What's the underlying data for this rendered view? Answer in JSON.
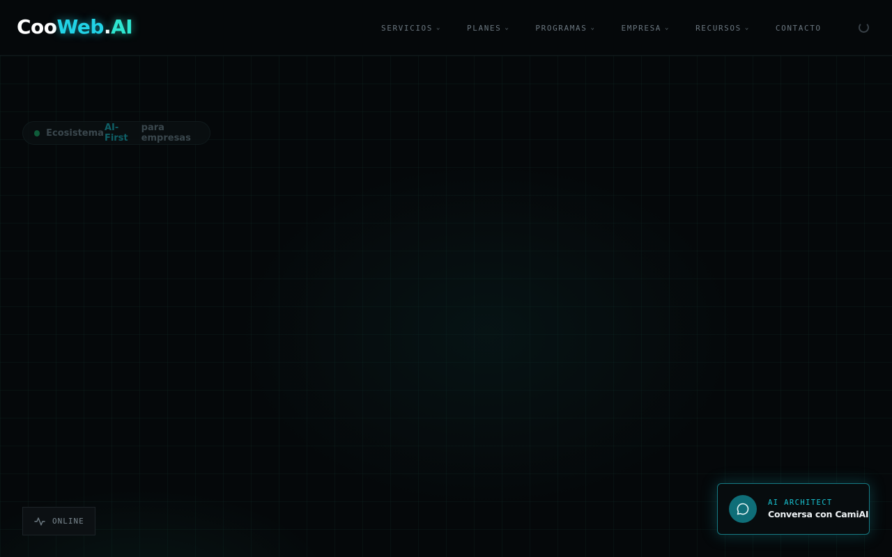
{
  "brand": {
    "part1": "Coo",
    "part2": "Web",
    "part3": ".",
    "part4": "AI"
  },
  "nav": {
    "items": [
      {
        "label": "SERVICIOS",
        "dropdown": true
      },
      {
        "label": "PLANES",
        "dropdown": true
      },
      {
        "label": "PROGRAMAS",
        "dropdown": true
      },
      {
        "label": "EMPRESA",
        "dropdown": true
      },
      {
        "label": "RECURSOS",
        "dropdown": true
      },
      {
        "label": "CONTACTO",
        "dropdown": false
      }
    ]
  },
  "hero": {
    "badge": {
      "pre": "Ecosistema",
      "highlight": "AI-First",
      "post": "para empresas"
    }
  },
  "status": {
    "label": "ONLINE",
    "icon": "activity-icon"
  },
  "chat_widget": {
    "eyebrow": "AI ARCHITECT",
    "title": "Conversa con CamiAI",
    "icon": "chat-bubble-icon"
  },
  "colors": {
    "background": "#05080a",
    "accent_cyan": "#22d3e6",
    "accent_teal": "#2ee6d0",
    "chat_border": "#167a83"
  }
}
